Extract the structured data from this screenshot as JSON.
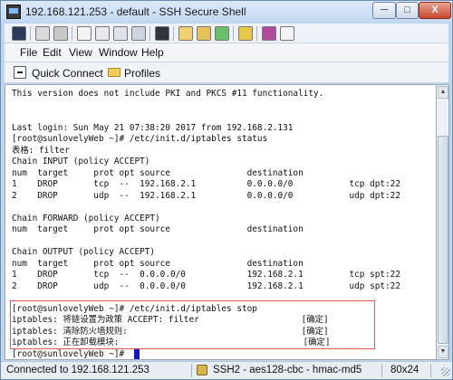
{
  "window": {
    "title": "192.168.121.253 - default - SSH Secure Shell",
    "minimize_glyph": "─",
    "maximize_glyph": "□",
    "close_glyph": "X"
  },
  "toolbar": {
    "icons": [
      "save-icon",
      "print-icon",
      "print-preview-icon",
      "find-icon",
      "copy-icon",
      "paste-icon",
      "paste-alt-icon",
      "binoculars-icon",
      "quick-connect-icon",
      "profiles-icon",
      "settings-icon",
      "file-transfer-icon",
      "bookmark-icon",
      "help-icon"
    ]
  },
  "menu": {
    "items": [
      "File",
      "Edit",
      "View",
      "Window",
      "Help"
    ]
  },
  "profilebar": {
    "quick_connect": "Quick Connect",
    "profiles": "Profiles"
  },
  "terminal": {
    "lines": [
      "This version does not include PKI and PKCS #11 functionality.",
      "",
      "",
      "Last login: Sun May 21 07:38:20 2017 from 192.168.2.131",
      "[root@sunlovelyWeb ~]# /etc/init.d/iptables status",
      "表格: filter",
      "Chain INPUT (policy ACCEPT)",
      "num  target     prot opt source               destination",
      "1    DROP       tcp  --  192.168.2.1          0.0.0.0/0           tcp dpt:22",
      "2    DROP       udp  --  192.168.2.1          0.0.0.0/0           udp dpt:22",
      "",
      "Chain FORWARD (policy ACCEPT)",
      "num  target     prot opt source               destination",
      "",
      "Chain OUTPUT (policy ACCEPT)",
      "num  target     prot opt source               destination",
      "1    DROP       tcp  --  0.0.0.0/0            192.168.2.1         tcp spt:22",
      "2    DROP       udp  --  0.0.0.0/0            192.168.2.1         udp spt:22",
      "",
      "[root@sunlovelyWeb ~]# /etc/init.d/iptables stop",
      "iptables: 将链设置为政策 ACCEPT: filter                    [确定]",
      "iptables: 清除防火墙规则:                                  [确定]",
      "iptables: 正在卸载模块:                                    [确定]",
      "[root@sunlovelyWeb ~]# "
    ],
    "highlight_color": "#e45a5a",
    "cursor_color": "#1414c8"
  },
  "statusbar": {
    "connection": "Connected to 192.168.121.253",
    "protocol": "SSH2 - aes128-cbc - hmac-md5",
    "size": "80x24"
  }
}
